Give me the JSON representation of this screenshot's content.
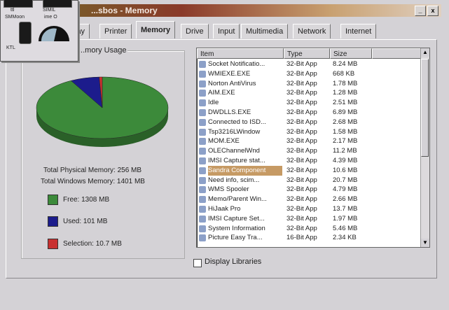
{
  "window": {
    "title": "...sbos - Memory",
    "min_glyph": "_",
    "close_glyph": "x"
  },
  "tabs": [
    {
      "label": "lay"
    },
    {
      "label": "Printer"
    },
    {
      "label": "Memory",
      "active": true
    },
    {
      "label": "Drive"
    },
    {
      "label": "Input"
    },
    {
      "label": "Multimedia"
    },
    {
      "label": "Network"
    },
    {
      "label": "Internet"
    }
  ],
  "memory_usage": {
    "group_label": "...mory Usage",
    "total_physical": "Total Physical Memory: 256 MB",
    "total_windows": "Total Windows Memory: 1401 MB",
    "legend": [
      {
        "label": "Free: 1308 MB",
        "color": "#3c8a3a",
        "value": 1308
      },
      {
        "label": "Used: 101 MB",
        "color": "#1c1c8c",
        "value": 101
      },
      {
        "label": "Selection: 10.7 MB",
        "color": "#c83030",
        "value": 10.7
      }
    ]
  },
  "process_list": {
    "columns": [
      "Item",
      "Type",
      "Size"
    ],
    "rows": [
      {
        "item": "Socket Notificatio...",
        "type": "32-Bit App",
        "size": "8.24 MB"
      },
      {
        "item": "WMIEXE.EXE",
        "type": "32-Bit App",
        "size": "668 KB"
      },
      {
        "item": "Norton AntiVirus",
        "type": "32-Bit App",
        "size": "1.78 MB"
      },
      {
        "item": "AIM.EXE",
        "type": "32-Bit App",
        "size": "1.28 MB"
      },
      {
        "item": "Idle",
        "type": "32-Bit App",
        "size": "2.51 MB"
      },
      {
        "item": "DWDLLS.EXE",
        "type": "32-Bit App",
        "size": "6.89 MB"
      },
      {
        "item": "Connected to ISD...",
        "type": "32-Bit App",
        "size": "2.68 MB"
      },
      {
        "item": "Tsp3216LWindow",
        "type": "32-Bit App",
        "size": "1.58 MB"
      },
      {
        "item": "MOM.EXE",
        "type": "32-Bit App",
        "size": "2.17 MB"
      },
      {
        "item": "OLEChannelWnd",
        "type": "32-Bit App",
        "size": "11.2 MB"
      },
      {
        "item": "IMSI Capture stat...",
        "type": "32-Bit App",
        "size": "4.39 MB"
      },
      {
        "item": "Sandra Component",
        "type": "32-Bit App",
        "size": "10.6 MB",
        "selected": true
      },
      {
        "item": "Need info, scim...",
        "type": "32-Bit App",
        "size": "20.7 MB"
      },
      {
        "item": "WMS Spooler",
        "type": "32-Bit App",
        "size": "4.79 MB"
      },
      {
        "item": "Memo/Parent Win...",
        "type": "32-Bit App",
        "size": "2.66 MB"
      },
      {
        "item": "HiJaak Pro",
        "type": "32-Bit App",
        "size": "13.7 MB"
      },
      {
        "item": "IMSI Capture Set...",
        "type": "32-Bit App",
        "size": "1.97 MB"
      },
      {
        "item": "System Information",
        "type": "32-Bit App",
        "size": "5.46 MB"
      },
      {
        "item": "Picture Easy Tra...",
        "type": "16-Bit App",
        "size": "2.34 KB"
      }
    ]
  },
  "display_libraries": {
    "label": "Display Libraries",
    "checked": false
  },
  "mini_window": {
    "labels": [
      "ttl",
      "SIMIL",
      "SMMoon",
      "ime O",
      "KTL"
    ]
  }
}
